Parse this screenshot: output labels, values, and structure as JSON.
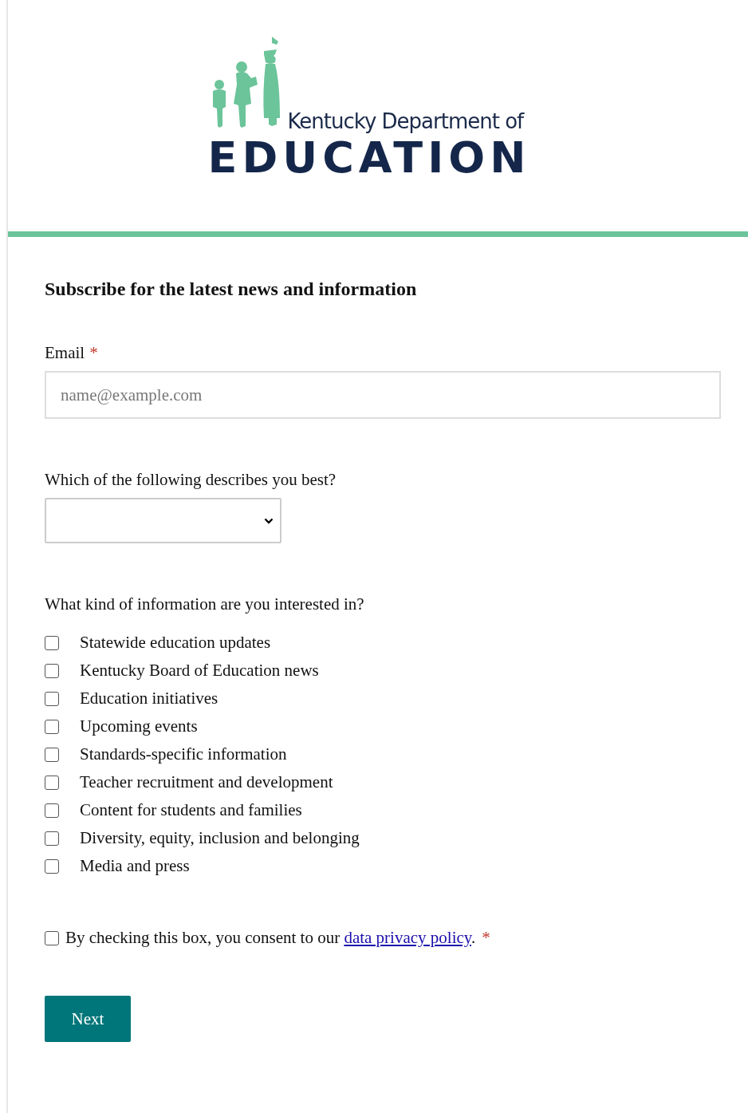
{
  "logo": {
    "subtitle": "Kentucky Department of",
    "title": "EDUCATION"
  },
  "form": {
    "heading": "Subscribe for the latest news and information",
    "email": {
      "label": "Email",
      "required_mark": "*",
      "placeholder": "name@example.com"
    },
    "role": {
      "label": "Which of the following describes you best?"
    },
    "interests": {
      "label": "What kind of information are you interested in?",
      "options": [
        {
          "label": "Statewide education updates",
          "checked": false
        },
        {
          "label": "Kentucky Board of Education news",
          "checked": false
        },
        {
          "label": "Education initiatives",
          "checked": false
        },
        {
          "label": "Upcoming events",
          "checked": false
        },
        {
          "label": "Standards-specific information",
          "checked": false
        },
        {
          "label": "Teacher recruitment and development",
          "checked": false
        },
        {
          "label": "Content for students and families",
          "checked": false
        },
        {
          "label": "Diversity, equity, inclusion and belonging",
          "checked": false
        },
        {
          "label": "Media and press",
          "checked": false
        }
      ]
    },
    "consent": {
      "checked": false,
      "text_before": "By checking this box, you consent to our ",
      "link": "data privacy policy",
      "text_after": ".",
      "required_mark": "*"
    },
    "button": "Next"
  }
}
